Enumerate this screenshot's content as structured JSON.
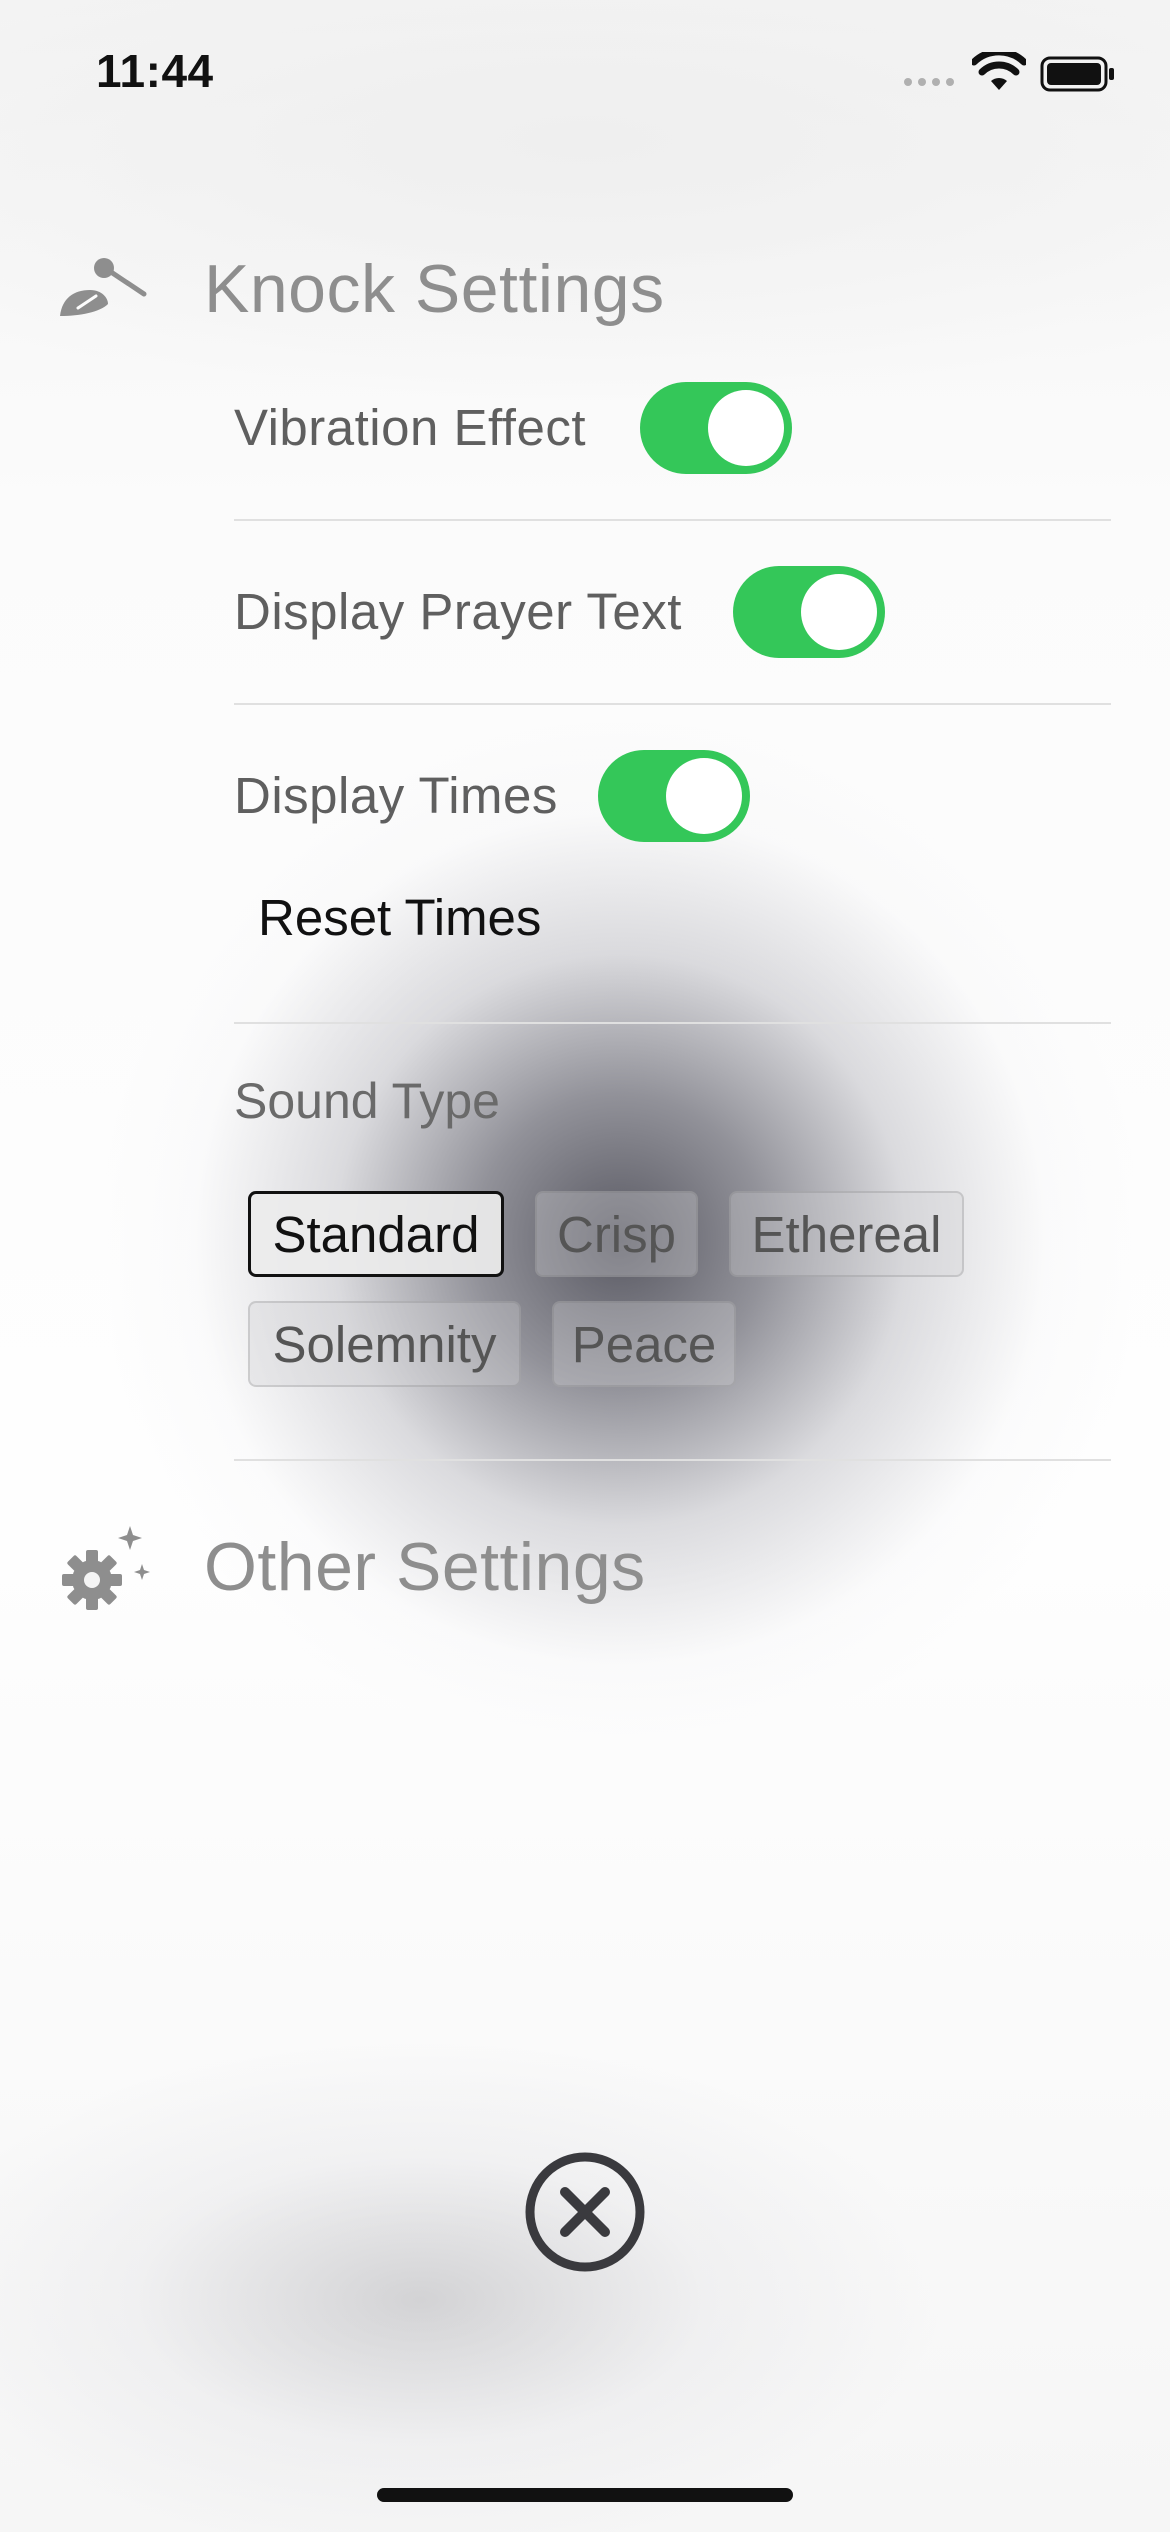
{
  "status_bar": {
    "time": "11:44",
    "icons": [
      "signal-dots-icon",
      "wifi-icon",
      "battery-icon"
    ]
  },
  "knock_settings": {
    "icon": "mallet-icon",
    "title": "Knock Settings",
    "vibration_label": "Vibration Effect",
    "vibration_on": true,
    "prayer_text_label": "Display Prayer Text",
    "prayer_text_on": true,
    "display_times_label": "Display Times",
    "display_times_on": true,
    "reset_label": "Reset Times",
    "sound_type_label": "Sound Type",
    "sound_types": [
      "Standard",
      "Crisp",
      "Ethereal",
      "Solemnity",
      "Peace"
    ],
    "selected_sound": "Standard"
  },
  "other_settings": {
    "icon": "gear-sparkle-icon",
    "title": "Other Settings"
  },
  "close": {
    "icon": "close-circle-icon"
  },
  "colors": {
    "toggle_on": "#34c759",
    "section_title": "#8e8e8e",
    "label": "#5f5f5f",
    "close_icon": "#3a3a3e"
  }
}
